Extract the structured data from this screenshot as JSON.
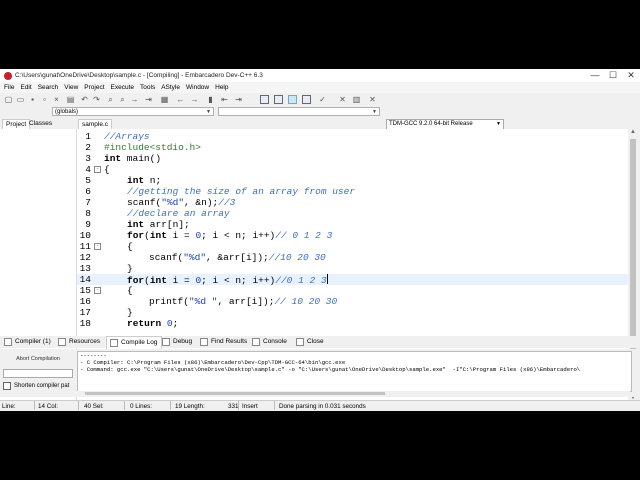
{
  "window": {
    "title": "C:\\Users\\gunat\\OneDrive\\Desktop\\sample.c - [Compiling] - Embarcadero Dev-C++ 6.3",
    "minimize": "—",
    "maximize": "☐",
    "close": "✕"
  },
  "menu": [
    "File",
    "Edit",
    "Search",
    "View",
    "Project",
    "Execute",
    "Tools",
    "AStyle",
    "Window",
    "Help"
  ],
  "toolbar": {
    "compiler_select": "TDM-GCC 9.2.0 64-bit Release"
  },
  "toolbar2": {
    "scope_select": "(globals)",
    "func_select": ""
  },
  "panel_tabs": {
    "project": "Project",
    "classes": "Classes",
    "file": "sample.c"
  },
  "editor": {
    "lines": [
      {
        "n": "1"
      },
      {
        "n": "2"
      },
      {
        "n": "3"
      },
      {
        "n": "4"
      },
      {
        "n": "5"
      },
      {
        "n": "6"
      },
      {
        "n": "7"
      },
      {
        "n": "8"
      },
      {
        "n": "9"
      },
      {
        "n": "10"
      },
      {
        "n": "11"
      },
      {
        "n": "12"
      },
      {
        "n": "13"
      },
      {
        "n": "14"
      },
      {
        "n": "15"
      },
      {
        "n": "16"
      },
      {
        "n": "17"
      },
      {
        "n": "18"
      }
    ],
    "code": {
      "l1": "//Arrays",
      "l2": "#include<stdio.h>",
      "l3_kw": "int",
      "l3_rest": " main()",
      "l4": "{",
      "l5_kw": "int",
      "l5_rest": " n;",
      "l6": "//getting the size of an array from user",
      "l7_a": "scanf(",
      "l7_str": "\"%d\"",
      "l7_b": ", &n);",
      "l7_cm": "//3",
      "l8": "//declare an array",
      "l9_kw": "int",
      "l9_rest": " arr[n];",
      "l10_kw": "for",
      "l10_a": "(",
      "l10_kw2": "int",
      "l10_b": " i = ",
      "l10_n0": "0",
      "l10_c": "; i < n; i++)",
      "l10_cm": "// 0 1 2 3",
      "l11": "{",
      "l12_a": "scanf(",
      "l12_str": "\"%d\"",
      "l12_b": ", &arr[i]);",
      "l12_cm": "//10 20 30",
      "l13": "}",
      "l14_kw": "for",
      "l14_a": "(",
      "l14_kw2": "int",
      "l14_b": " i = ",
      "l14_n0": "0",
      "l14_c": "; i < n; i++)",
      "l14_cm": "//0 1 2 3",
      "l15": "{",
      "l16_a": "printf(",
      "l16_str": "\"%d \"",
      "l16_b": ", arr[i]);",
      "l16_cm": "// 10 20 30",
      "l17": "}",
      "l18_kw": "return",
      "l18_sp": " ",
      "l18_n": "0",
      "l18_end": ";"
    }
  },
  "bottom_tabs": {
    "compiler": "Compiler (1)",
    "resources": "Resources",
    "compile_log": "Compile Log",
    "debug": "Debug",
    "find_results": "Find Results",
    "console": "Console",
    "close": "Close"
  },
  "bottom_panel": {
    "abort": "Abort Compilation",
    "shorten": "Shorten compiler pat",
    "log_lines": [
      "--------",
      "- C Compiler: C:\\Program Files (x86)\\Embarcadero\\Dev-Cpp\\TDM-GCC-64\\bin\\gcc.exe",
      "- Command: gcc.exe \"C:\\Users\\gunat\\OneDrive\\Desktop\\sample.c\" -o \"C:\\Users\\gunat\\OneDrive\\Desktop\\sample.exe\"  -I\"C:\\Program Files (x86)\\Embarcadero\\"
    ]
  },
  "status": {
    "line_label": "Line:",
    "col_label": "14 Col:",
    "sel_label": "40 Sel:",
    "lines_label": "0 Lines:",
    "length_label": "19 Length:",
    "length_val": "331",
    "insert": "Insert",
    "message": "Done parsing in 0.031 seconds"
  }
}
